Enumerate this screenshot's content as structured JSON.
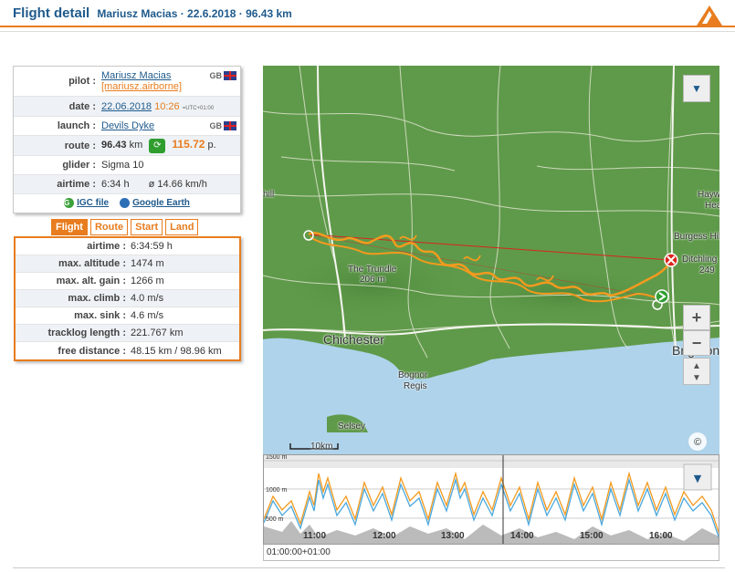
{
  "header": {
    "title": "Flight detail",
    "subtitle": "Mariusz Macias · 22.6.2018 · 96.43 km"
  },
  "info": {
    "pilot_label": "pilot :",
    "pilot_name": "Mariusz Macias",
    "pilot_handle": "[mariusz.airborne]",
    "pilot_country": "GB",
    "date_label": "date :",
    "date": "22.06.2018",
    "time": "10:26",
    "tz": "=UTC+01:00",
    "launch_label": "launch :",
    "launch": "Devils Dyke",
    "launch_country": "GB",
    "route_label": "route :",
    "route_km": "96.43",
    "route_unit": "km",
    "route_points": "115.72",
    "route_points_unit": "p.",
    "glider_label": "glider :",
    "glider": "Sigma 10",
    "airtime_label": "airtime :",
    "airtime": "6:34 h",
    "avg_speed": "ø 14.66 km/h",
    "igc_label": "IGC file",
    "earth_label": "Google Earth"
  },
  "tabs": [
    "Flight",
    "Route",
    "Start",
    "Land"
  ],
  "flight": [
    {
      "label": "airtime :",
      "value": "6:34:59 h"
    },
    {
      "label": "max. altitude :",
      "value": "1474 m"
    },
    {
      "label": "max. alt. gain :",
      "value": "1266 m"
    },
    {
      "label": "max. climb :",
      "value": "4.0 m/s"
    },
    {
      "label": "max. sink :",
      "value": "4.6 m/s"
    },
    {
      "label": "tracklog length :",
      "value": "221.767 km"
    },
    {
      "label": "free distance :",
      "value": "48.15 km / 98.96 km"
    }
  ],
  "map": {
    "labels": {
      "chichester": "Chichester",
      "trundle": "The Trundle",
      "trundle_alt": "206 m",
      "bognor": "Bognor",
      "regis": "Regis",
      "selsey": "Selsey",
      "burgess": "Burgess Hill",
      "ditchling": "Ditchling",
      "brighton": "Brighton",
      "hayw": "Hayw",
      "hea": "Hea",
      "hill": "hill",
      "alt249": "249"
    },
    "scale": "10km",
    "zoom_in": "+",
    "zoom_out": "−",
    "colors": {
      "land": "#5f9a4a",
      "sea": "#aed3ea",
      "track": "#f39a1e",
      "route": "#d9251c"
    }
  },
  "profile": {
    "y_labels": [
      "1500 m",
      "1000 m",
      "500 m"
    ],
    "times": [
      "11:00",
      "12:00",
      "13:00",
      "14:00",
      "15:00",
      "16:00"
    ],
    "footer": "01:00:00+01:00"
  }
}
